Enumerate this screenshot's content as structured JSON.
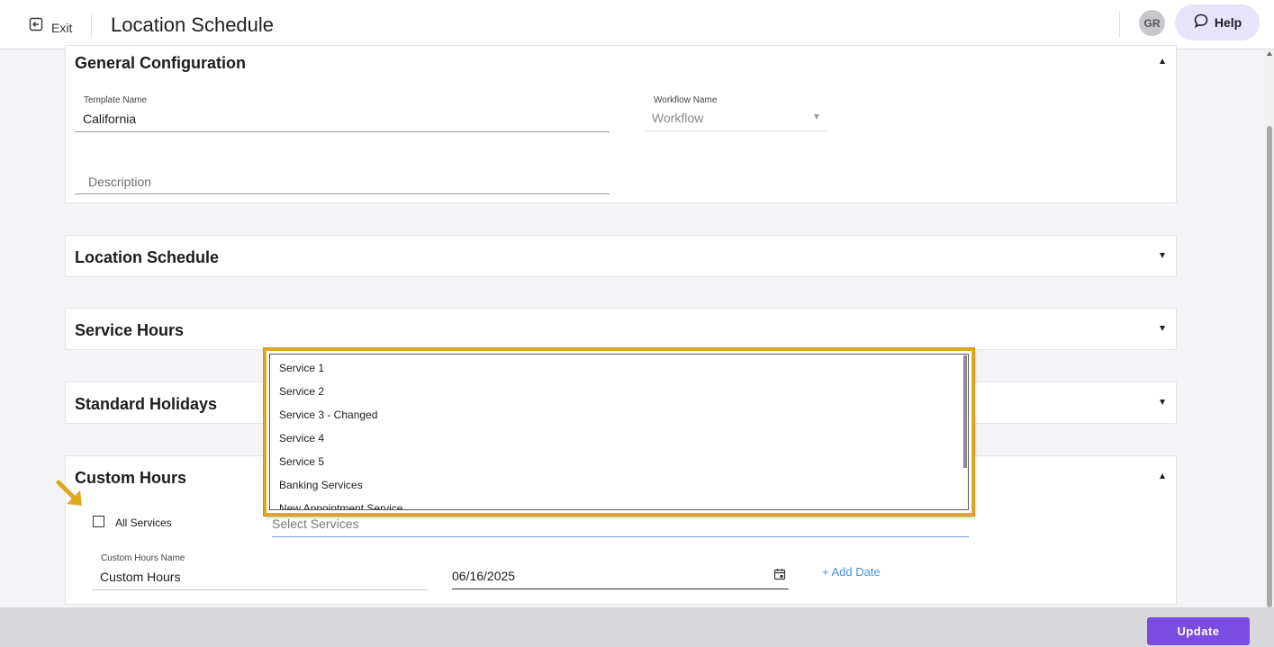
{
  "header": {
    "exit_label": "Exit",
    "title": "Location Schedule",
    "avatar_initials": "GR",
    "help_label": "Help"
  },
  "general_configuration": {
    "title": "General Configuration",
    "template_name_label": "Template Name",
    "template_name_value": "California",
    "workflow_name_label": "Workflow Name",
    "workflow_name_value": "Workflow",
    "description_placeholder": "Description",
    "expanded": true
  },
  "sections": [
    {
      "title": "Location Schedule",
      "expanded": false
    },
    {
      "title": "Service Hours",
      "expanded": false
    },
    {
      "title": "Standard Holidays",
      "expanded": false
    }
  ],
  "custom_hours": {
    "title": "Custom Hours",
    "expanded": true,
    "all_services_label": "All Services",
    "all_services_checked": false,
    "select_services_placeholder": "Select Services",
    "custom_hours_name_label": "Custom Hours Name",
    "custom_hours_name_value": "Custom Hours",
    "date_value": "06/16/2025",
    "add_date_label": "+ Add Date"
  },
  "services_dropdown": {
    "options": [
      "Service 1",
      "Service 2",
      "Service 3 - Changed",
      "Service 4",
      "Service 5",
      "Banking Services",
      "New Appointment Service"
    ]
  },
  "footer": {
    "update_label": "Update"
  },
  "colors": {
    "accent": "#7a4ce0",
    "highlight": "#e0a820",
    "link": "#4a90e2",
    "help_bg": "#e6e3fb"
  }
}
